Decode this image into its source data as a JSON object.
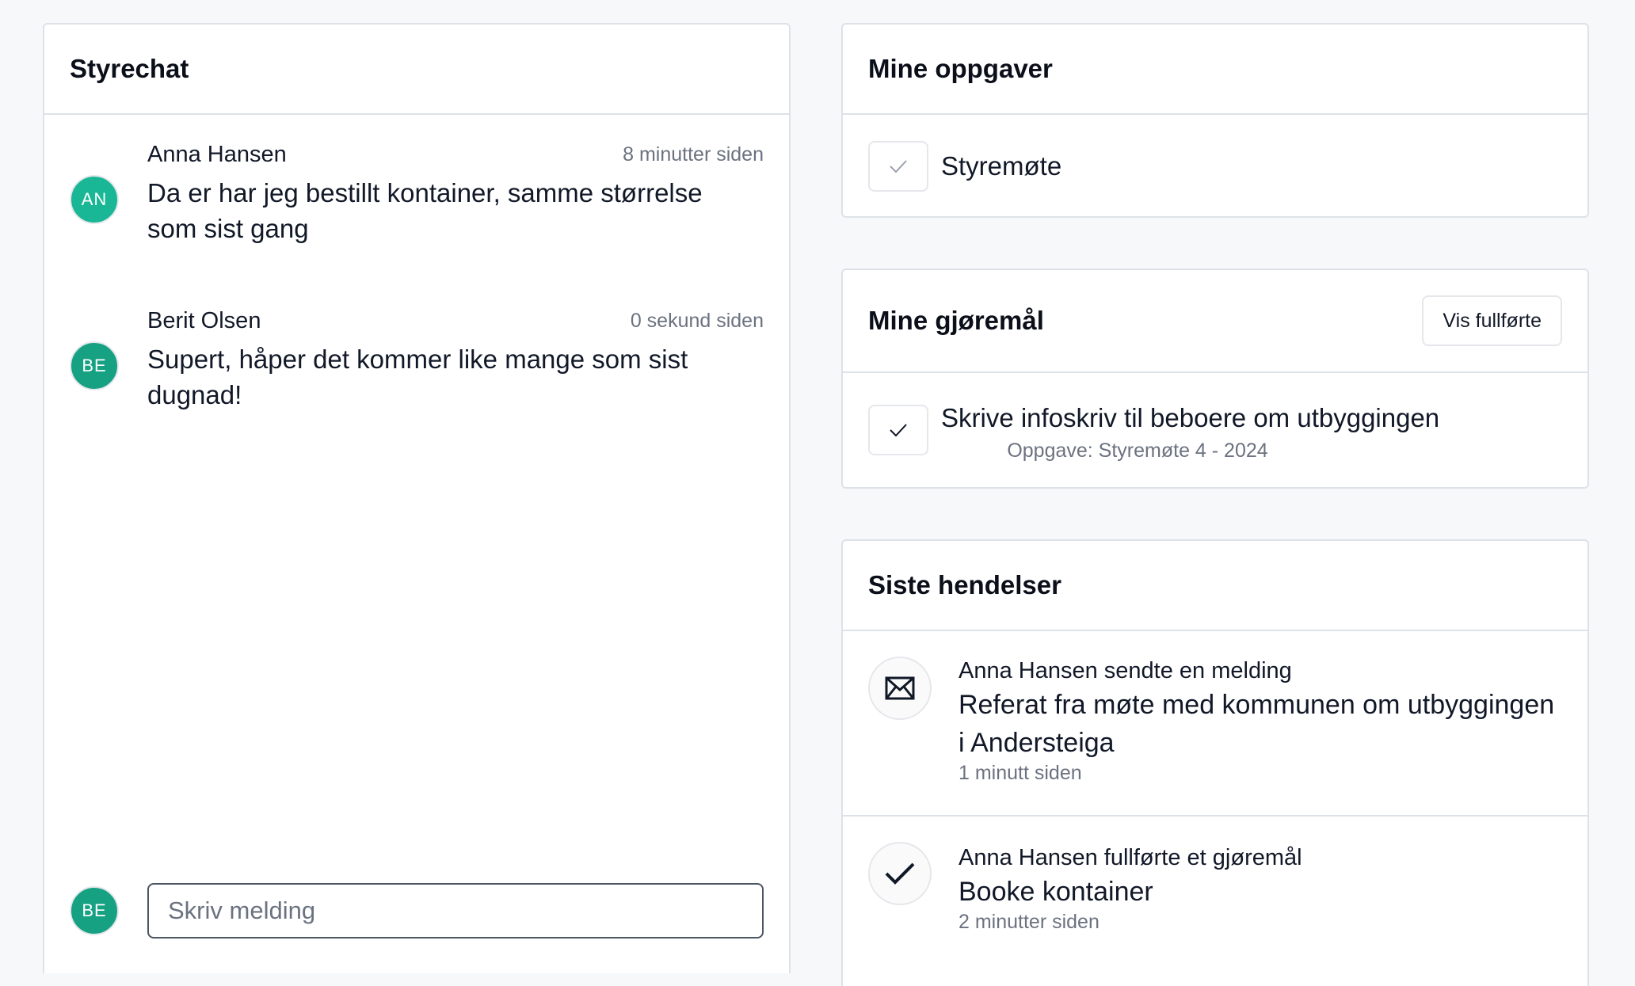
{
  "chat": {
    "title": "Styrechat",
    "messages": [
      {
        "initials": "AN",
        "author": "Anna Hansen",
        "time": "8 minutter siden",
        "text": "Da er har jeg bestillt kontainer, samme størrelse som sist gang",
        "avatar_color": "#19b795"
      },
      {
        "initials": "BE",
        "author": "Berit Olsen",
        "time": "0 sekund siden",
        "text": "Supert, håper det kommer like mange som sist dugnad!",
        "avatar_color": "#16a183"
      }
    ],
    "composer": {
      "initials": "BE",
      "avatar_color": "#16a183",
      "placeholder": "Skriv melding"
    }
  },
  "tasks": {
    "title": "Mine oppgaver",
    "items": [
      {
        "label": "Styremøte",
        "check_icon": "check-icon"
      }
    ]
  },
  "todos": {
    "title": "Mine gjøremål",
    "show_completed_label": "Vis fullførte",
    "items": [
      {
        "label": "Skrive infoskriv til beboere om utbyggingen",
        "subtitle": "Oppgave: Styremøte 4 - 2024",
        "check_icon": "check-icon"
      }
    ]
  },
  "events": {
    "title": "Siste hendelser",
    "items": [
      {
        "icon": "envelope-icon",
        "actor": "Anna Hansen sendte en melding",
        "title": "Referat fra møte med kommunen om utbyggingen i Andersteiga",
        "time": "1 minutt siden"
      },
      {
        "icon": "check-icon",
        "actor": "Anna Hansen fullførte et gjøremål",
        "title": "Booke kontainer",
        "time": "2 minutter siden"
      }
    ]
  }
}
